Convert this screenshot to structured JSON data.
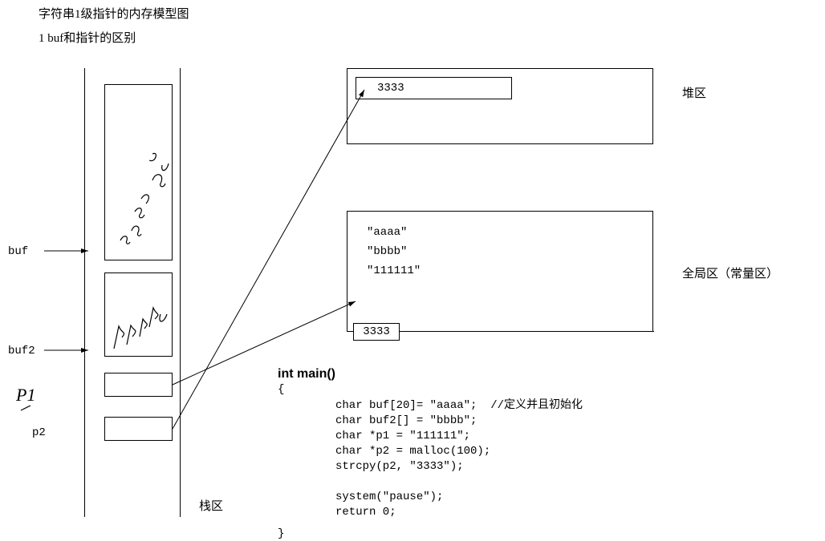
{
  "title": "字符串1级指针的内存模型图",
  "subtitle": "1 buf和指针的区别",
  "stack": {
    "region_label": "栈区",
    "buf_label": "buf",
    "buf2_label": "buf2",
    "p1_label": "P1",
    "p2_label": "p2"
  },
  "heap": {
    "region_label": "堆区",
    "value": "3333"
  },
  "global": {
    "region_label": "全局区（常量区）",
    "line1": "\"aaaa\"",
    "line2": "\"bbbb\"",
    "line3": "\"111111\"",
    "line4": "3333"
  },
  "code": {
    "head": "int main()",
    "brace_open": "{",
    "body": "char buf[20]= \"aaaa\";  //定义并且初始化\nchar buf2[] = \"bbbb\";\nchar *p1 = \"111111\";\nchar *p2 = malloc(100);\nstrcpy(p2, \"3333\");\n\nsystem(\"pause\");\nreturn 0;",
    "brace_close": "}"
  }
}
